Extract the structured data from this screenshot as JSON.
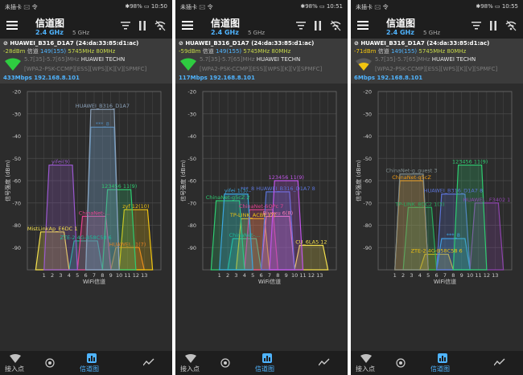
{
  "panels": [
    {
      "status_left": "未插卡 🖂 令",
      "status_right": "✱98% ▭ 10:50",
      "title": "信道图",
      "band_active": "2.4 GHz",
      "band_inactive": "5 GHz",
      "connected": {
        "ssid": "HUAWEI_B316_D1A7 (24:da:33:85:d1:ac)",
        "signal": "-28dBm",
        "channel_label": "信道",
        "channel": "149(155)",
        "freq": "5745MHz  80MHz",
        "range": "5.7[35]-5.7[65]MHz",
        "vendor": "HUAWEI TECHN",
        "capabilities": "[WPA2-PSK-CCMP][ESS][WPS][K][V][SPMFC]",
        "speed_ip": "433Mbps 192.168.8.101",
        "signal_color": "#2ecc40"
      },
      "chart_data": {
        "type": "area",
        "xlabel": "WiFi信道",
        "ylabel": "信号强度 (dBm)",
        "ylim": [
          -100,
          -20
        ],
        "yticks": [
          -20,
          -30,
          -40,
          -50,
          -60,
          -70,
          -80,
          -90
        ],
        "xticks": [
          "1",
          "2",
          "3",
          "4",
          "5",
          "6",
          "7",
          "8",
          "9",
          "10",
          "11",
          "12",
          "13"
        ],
        "series": [
          {
            "name": "HUAWEI_B316_D1A7",
            "channel": 8,
            "dbm": -28,
            "color": "#8aa0b8"
          },
          {
            "name": "***_8",
            "channel": 8,
            "dbm": -36,
            "color": "#4f86b5"
          },
          {
            "name": "yifei(9)",
            "channel": 3,
            "dbm": -53,
            "color": "#9b59d0"
          },
          {
            "name": "123456 11(9)",
            "channel": 10,
            "dbm": -64,
            "color": "#2ecc71"
          },
          {
            "name": "zyf 12(10)",
            "channel": 12,
            "dbm": -73,
            "color": "#f1c40f"
          },
          {
            "name": "ChinaNet-...",
            "channel": 7,
            "dbm": -76,
            "color": "#e84393"
          },
          {
            "name": "MistLinkAp_E6DC 1",
            "channel": 2,
            "dbm": -83,
            "color": "#f4e04d"
          },
          {
            "name": "ZTE-2.4G-B58C58 6",
            "channel": 6,
            "dbm": -87,
            "color": "#1abc9c"
          },
          {
            "name": "HUAWEI...1(7)",
            "channel": 11,
            "dbm": -90,
            "color": "#e67e22"
          }
        ]
      }
    },
    {
      "status_left": "未插卡 🖂 令",
      "status_right": "✱98% ▭ 10:51",
      "title": "信道图",
      "band_active": "2.4 GHz",
      "band_inactive": "5 GHz",
      "connected": {
        "ssid": "HUAWEI_B316_D1A7 (24:da:33:85:d1:ac)",
        "signal": "-59dBm",
        "channel_label": "信道",
        "channel": "149(155)",
        "freq": "5745MHz  80MHz",
        "range": "5.7[35]-5.7[65]MHz",
        "vendor": "HUAWEI TECHN",
        "capabilities": "[WPA2-PSK-CCMP][ESS][WPS][K][V][SPMFC]",
        "speed_ip": "117Mbps 192.168.8.101",
        "signal_color": "#2ecc40"
      },
      "chart_data": {
        "type": "area",
        "xlabel": "WiFi信道",
        "ylabel": "信号强度 (dBm)",
        "ylim": [
          -100,
          -20
        ],
        "yticks": [
          -20,
          -30,
          -40,
          -50,
          -60,
          -70,
          -80,
          -90
        ],
        "xticks": [
          "1",
          "2",
          "3",
          "4",
          "5",
          "6",
          "7",
          "8",
          "9",
          "10",
          "11",
          "12",
          "13"
        ],
        "series": [
          {
            "name": "123456 11(9)",
            "channel": 9,
            "dbm": -60,
            "color": "#c054e8"
          },
          {
            "name": "***_8 HUAWEI_B316_D1A7 8",
            "channel": 8,
            "dbm": -65,
            "color": "#5b73d8"
          },
          {
            "name": "yifei 1(3)",
            "channel": 3,
            "dbm": -66,
            "color": "#3aa6e0"
          },
          {
            "name": "ChinaNet-g5cZ 2",
            "channel": 2,
            "dbm": -69,
            "color": "#2ecc71"
          },
          {
            "name": "ChinaNet-6QPc 7",
            "channel": 6,
            "dbm": -73,
            "color": "#e84393"
          },
          {
            "name": "TP-LINK_ACBE (7)",
            "channel": 5,
            "dbm": -77,
            "color": "#f1c40f"
          },
          {
            "name": "Bluoxu 6(8)",
            "channel": 8,
            "dbm": -76,
            "color": "#ff7ab6"
          },
          {
            "name": "ChinaNet-...",
            "channel": 4,
            "dbm": -86,
            "color": "#1abc9c"
          },
          {
            "name": "CU_6LA5 12",
            "channel": 12,
            "dbm": -89,
            "color": "#f4e04d"
          }
        ]
      }
    },
    {
      "status_left": "未插卡 🖂 令",
      "status_right": "✱98% ▭ 10:55",
      "title": "信道图",
      "band_active": "2.4 GHz",
      "band_inactive": "5 GHz",
      "connected": {
        "ssid": "HUAWEI_B316_D1A7 (24:da:33:85:d1:ac)",
        "signal": "-71dBm",
        "channel_label": "信道",
        "channel": "149(155)",
        "freq": "5745MHz  80MHz",
        "range": "5.7[35]-5.7[65]MHz",
        "vendor": "HUAWEI TECHN",
        "capabilities": "[WPA2-PSK-CCMP][ESS][WPS][K][V][SPMFC]",
        "speed_ip": "6Mbps 192.168.8.101",
        "signal_color": "#f1c40f"
      },
      "chart_data": {
        "type": "area",
        "xlabel": "WiFi信道",
        "ylabel": "信号强度 (dBm)",
        "ylim": [
          -100,
          -20
        ],
        "yticks": [
          -20,
          -30,
          -40,
          -50,
          -60,
          -70,
          -80,
          -90
        ],
        "xticks": [
          "1",
          "2",
          "3",
          "4",
          "5",
          "6",
          "7",
          "8",
          "9",
          "10",
          "11",
          "12",
          "13"
        ],
        "series": [
          {
            "name": "123456 11(9)",
            "channel": 10,
            "dbm": -53,
            "color": "#2ecc71"
          },
          {
            "name": "ChinaNet-g_guest 3",
            "channel": 3,
            "dbm": -57,
            "color": "#7f8c8d"
          },
          {
            "name": "ChinaNet-q5cZ",
            "channel": 3,
            "dbm": -60,
            "color": "#f39c12"
          },
          {
            "name": "HUAWEI_B316_D1A7 8",
            "channel": 8,
            "dbm": -66,
            "color": "#5b73d8"
          },
          {
            "name": "TP-LINK_8DC2 1(3)",
            "channel": 4,
            "dbm": -72,
            "color": "#27ae60"
          },
          {
            "name": "***_8",
            "channel": 8,
            "dbm": -86,
            "color": "#3aa6e0"
          },
          {
            "name": "ZTE-2.4G-B58C58 6",
            "channel": 6,
            "dbm": -93,
            "color": "#f1c40f"
          },
          {
            "name": "HUAWEI...F3402 1",
            "channel": 12,
            "dbm": -70,
            "color": "#8e44ad"
          }
        ]
      }
    }
  ],
  "nav": {
    "ap": "接入点",
    "channel": "信道图"
  }
}
